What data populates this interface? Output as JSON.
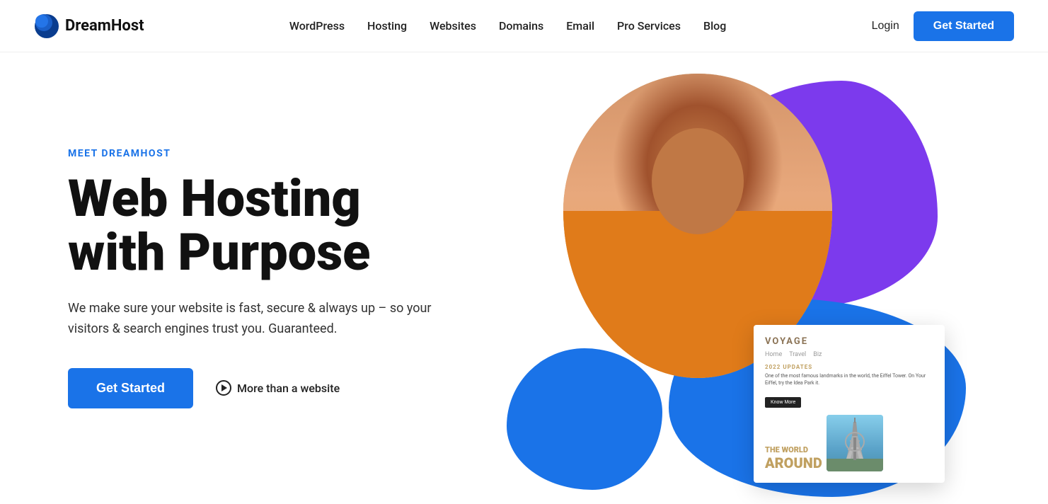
{
  "brand": {
    "name": "DreamHost",
    "logo_alt": "DreamHost logo"
  },
  "nav": {
    "links": [
      {
        "label": "WordPress",
        "id": "wordpress"
      },
      {
        "label": "Hosting",
        "id": "hosting"
      },
      {
        "label": "Websites",
        "id": "websites"
      },
      {
        "label": "Domains",
        "id": "domains"
      },
      {
        "label": "Email",
        "id": "email"
      },
      {
        "label": "Pro Services",
        "id": "pro-services"
      },
      {
        "label": "Blog",
        "id": "blog"
      }
    ],
    "login_label": "Login",
    "get_started_label": "Get Started"
  },
  "hero": {
    "eyebrow": "MEET DREAMHOST",
    "title_line1": "Web Hosting",
    "title_line2": "with Purpose",
    "description": "We make sure your website is fast, secure & always up – so your visitors & search engines trust you. Guaranteed.",
    "cta_primary": "Get Started",
    "cta_secondary": "More than a website"
  },
  "voyage_card": {
    "title": "VOYAGE",
    "nav_items": [
      "Home",
      "Travel",
      "Biz"
    ],
    "section": "2022 UPDATES",
    "body": "One of the most famous landmarks in the world, the Eiffel Tower. On Your Eiffel, try the Idea Park it.",
    "know_more": "Know More",
    "world_text": "THE WORLD",
    "around_text": "AROUND"
  }
}
